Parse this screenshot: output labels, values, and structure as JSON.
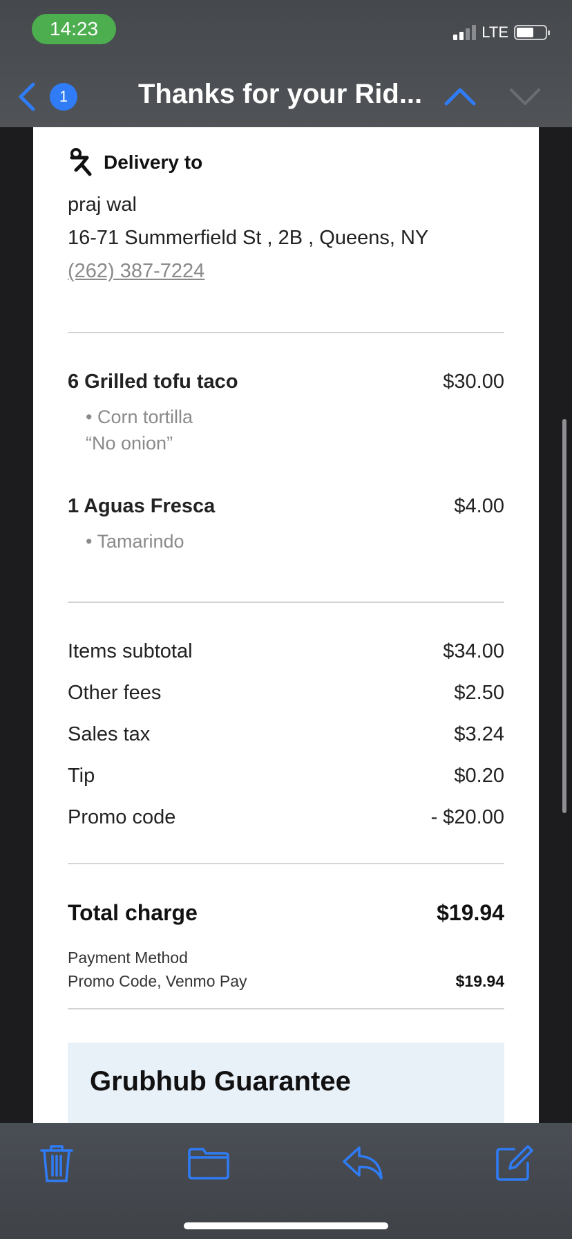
{
  "status_bar": {
    "time": "14:23",
    "network": "LTE"
  },
  "nav": {
    "badge_count": "1",
    "title": "Thanks for your Rid..."
  },
  "delivery": {
    "heading": "Delivery to",
    "name": "praj wal",
    "address": "16-71 Summerfield St , 2B , Queens, NY",
    "phone": "(262) 387-7224"
  },
  "items": [
    {
      "name": "6 Grilled tofu taco",
      "price": "$30.00",
      "options": [
        "• Corn tortilla"
      ],
      "note": "“No onion”"
    },
    {
      "name": "1 Aguas Fresca",
      "price": "$4.00",
      "options": [
        "• Tamarindo"
      ]
    }
  ],
  "summary": [
    {
      "label": "Items subtotal",
      "value": "$34.00"
    },
    {
      "label": "Other fees",
      "value": "$2.50"
    },
    {
      "label": "Sales tax",
      "value": "$3.24"
    },
    {
      "label": "Tip",
      "value": "$0.20"
    },
    {
      "label": "Promo code",
      "value": "- $20.00"
    }
  ],
  "total": {
    "label": "Total charge",
    "value": "$19.94",
    "payment_label": "Payment Method",
    "payment_methods": "Promo Code, Venmo Pay",
    "payment_value": "$19.94"
  },
  "guarantee": {
    "heading": "Grubhub Guarantee"
  },
  "colors": {
    "accent": "#2f7cf6",
    "status_green": "#4cae4f"
  },
  "toolbar_icons": [
    "trash-icon",
    "folder-icon",
    "reply-icon",
    "compose-icon"
  ]
}
